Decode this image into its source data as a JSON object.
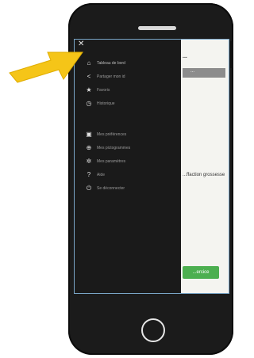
{
  "colors": {
    "phone_body": "#1b1b1b",
    "drawer_bg": "#1a1a1a",
    "arrow": "#f5c518",
    "accent_green": "#4caf50",
    "header_strip": "#8c8c8c"
  },
  "drawer": {
    "close_icon": "close-icon",
    "items": [
      {
        "icon": "home-icon",
        "label": "Tableau de bord"
      },
      {
        "icon": "share-icon",
        "label": "Partager mon id"
      },
      {
        "icon": "star-icon",
        "label": "Favoris"
      },
      {
        "icon": "history-icon",
        "label": "Historique"
      },
      {
        "icon": "edit-icon",
        "label": "Mes préférences"
      },
      {
        "icon": "globe-icon",
        "label": "Mes pictogrammes"
      },
      {
        "icon": "settings-icon",
        "label": "Mes paramètres"
      },
      {
        "icon": "help-icon",
        "label": "Aide"
      },
      {
        "icon": "power-icon",
        "label": "Se déconnecter"
      }
    ]
  },
  "background_page": {
    "title": "...",
    "header_label": "...",
    "text_fragment": "...ffaction grossesse",
    "button_label": "...ercice"
  }
}
